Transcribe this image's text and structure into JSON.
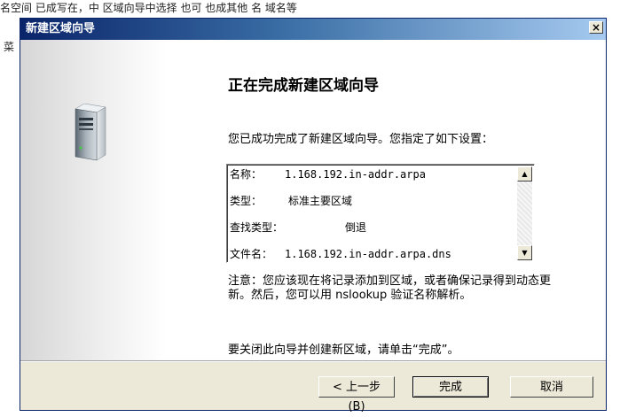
{
  "background": {
    "top_text": "名空间 已成写在，中 区域向导中选择 也可 也成其他 名 域名等",
    "side_text": "菜"
  },
  "dialog": {
    "title": "新建区域向导",
    "close_label": "×",
    "heading": "正在完成新建区域向导",
    "intro": "您已成功完成了新建区域向导。您指定了如下设置：",
    "summary": [
      {
        "label": "名称：",
        "value": "1.168.192.in-addr.arpa"
      },
      {
        "label": "类型：",
        "value": "标准主要区域"
      },
      {
        "label": "查找类型：",
        "value": "倒退"
      },
      {
        "label": "文件名：",
        "value": "1.168.192.in-addr.arpa.dns"
      }
    ],
    "note": "注意：您应该现在将记录添加到区域，或者确保记录得到动态更新。然后，您可以用 nslookup 验证名称解析。",
    "closing": "要关闭此向导并创建新区域，请单击“完成”。",
    "buttons": {
      "back": "< 上一步(B)",
      "finish": "完成",
      "cancel": "取消"
    }
  },
  "icons": {
    "server": "server-icon",
    "scroll_up": "scroll-up-arrow-icon",
    "scroll_down": "scroll-down-arrow-icon"
  }
}
